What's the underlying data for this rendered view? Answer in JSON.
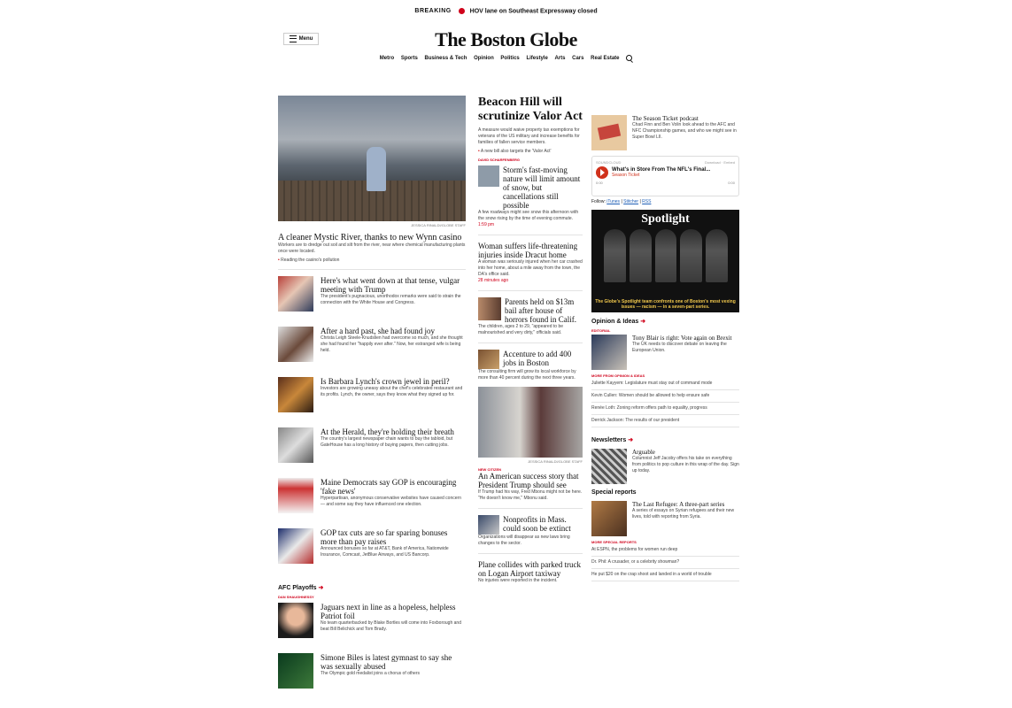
{
  "breaking": {
    "tag": "BREAKING",
    "text": "HOV lane on Southeast Expressway closed"
  },
  "header": {
    "menu_label": "Menu",
    "logo": "The Boston Globe",
    "nav": [
      "Metro",
      "Sports",
      "Business & Tech",
      "Opinion",
      "Politics",
      "Lifestyle",
      "Arts",
      "Cars",
      "Real Estate"
    ]
  },
  "col1": {
    "hero_credit": "JESSICA RINALDI/GLOBE STAFF",
    "lead_head": "A cleaner Mystic River, thanks to new Wynn casino",
    "lead_summary": "Workers are to dredge out soil and silt from the river, near where chemical manufacturing plants once were located.",
    "lead_bullet": "Reading the casino's pollution",
    "stories": [
      {
        "head": "Here's what went down at that tense, vulgar meeting with Trump",
        "summary": "The president's pugnacious, unorthodox remarks were said to strain the connection with the White House and Congress."
      },
      {
        "head": "After a hard past, she had found joy",
        "summary": "Christa Leigh Steele-Knudslien had overcome so much, and she thought she had found her \"happily ever after.\" Now, her estranged wife is being held."
      },
      {
        "head": "Is Barbara Lynch's crown jewel in peril?",
        "summary": "Investors are growing uneasy about the chef's celebrated restaurant and its profits. Lynch, the owner, says they know what they signed up for."
      },
      {
        "head": "At the Herald, they're holding their breath",
        "summary": "The country's largest newspaper chain wants to buy the tabloid, but GateHouse has a long history of buying papers, then cutting jobs."
      },
      {
        "head": "Maine Democrats say GOP is encouraging 'fake news'",
        "summary": "Hyperpartisan, anonymous conservative websites have caused concern — and some say they have influenced one election."
      },
      {
        "head": "GOP tax cuts are so far sparing bonuses more than pay raises",
        "summary": "Announced bonuses so far at AT&T, Bank of America, Nationwide Insurance, Comcast, JetBlue Airways, and US Bancorp."
      }
    ],
    "afc_label": "AFC Playoffs",
    "afc_kicker": "DAN SHAUGHNESSY",
    "afc_stories": [
      {
        "head": "Jaguars next in line as a hopeless, helpless Patriot foil",
        "summary": "No team quarterbacked by Blake Bortles will come into Foxborough and beat Bill Belichick and Tom Brady."
      },
      {
        "head": "Simone Biles is latest gymnast to say she was sexually abused",
        "summary": "The Olympic gold medalist joins a chorus of others"
      }
    ]
  },
  "col2": {
    "lead_head": "Beacon Hill will scrutinize Valor Act",
    "lead_summary": "A measure would waive property tax exemptions for veterans of the US military and increase benefits for families of fallen service members.",
    "lead_bullet": "A new bill also targets the 'Valor Act'",
    "kicker": "DAVID SCHARFENBERG",
    "stories": [
      {
        "head": "Storm's fast-moving nature will limit amount of snow, but cancellations still possible",
        "summary": "A few roadways might see snow this afternoon with the snow rising by the time of evening commute.",
        "tag": "1:59 pm"
      },
      {
        "head": "Woman suffers life-threatening injuries inside Dracut home",
        "summary": "A woman was seriously injured when her car crashed into her home, about a mile away from the town, the DA's office said.",
        "tag": "28 minutes ago"
      },
      {
        "head": "Parents held on $13m bail after house of horrors found in Calif.",
        "summary": "The children, ages 2 to 29, \"appeared to be malnourished and very dirty,\" officials said."
      },
      {
        "head": "Accenture to add 400 jobs in Boston",
        "summary": "The consulting firm will grow its local workforce by more than 40 percent during the next three years."
      }
    ],
    "portrait_credit": "JESSICA RINALDI/GLOBE STAFF",
    "feature_kicker": "NEW CITIZEN",
    "feature_head": "An American success story that President Trump should see",
    "feature_summary": "If Trump had his way, Fred Mbonu might not be here. \"He doesn't know me,\" Mbonu said.",
    "more_stories": [
      {
        "head": "Nonprofits in Mass. could soon be extinct",
        "summary": "Organizations will disappear as new laws bring changes to the sector."
      },
      {
        "head": "Plane collides with parked truck on Logan Airport taxiway",
        "summary": "No injuries were reported in the incident."
      }
    ]
  },
  "col3": {
    "podcast_title": "The Season Ticket podcast",
    "podcast_desc": "Chad Finn and Ben Volin look ahead to the AFC and NFC Championship games, and who we might see in Super Bowl LII.",
    "player": {
      "brand": "SOUNDCLOUD",
      "episode": "What's in Store From The NFL's Final...",
      "show": "Season Ticket",
      "time_start": "0:00",
      "time_end": "0:00",
      "download": "Download",
      "embed": "Embed"
    },
    "follow": {
      "label": "Follow:",
      "links": [
        "iTunes",
        "Stitcher",
        "RSS"
      ]
    },
    "spotlight": {
      "title": "Spotlight",
      "caption": "The Globe's Spotlight team confronts one of Boston's most vexing issues — racism — in a seven-part series."
    },
    "opinion": {
      "label": "Opinion & Ideas",
      "kicker": "EDITORIAL",
      "head": "Tony Blair is right: Vote again on Brexit",
      "summary": "The UK needs to discover debate on leaving the European Union.",
      "kicker2": "MORE FROM OPINION & IDEAS",
      "items": [
        "Juliette Kayyem: Legislature must stay out of command mode",
        "Kevin Cullen: Women should be allowed to help ensure safe",
        "Renée Loth: Zoning reform offers path to equality, progress",
        "Derrick Jackson: The results of our president"
      ]
    },
    "newsletters": {
      "label": "Newsletters",
      "title": "Arguable",
      "desc": "Columnist Jeff Jacoby offers his take on everything from politics to pop culture in this wrap of the day. Sign up today."
    },
    "special": {
      "label": "Special reports",
      "head": "The Last Refugee: A three-part series",
      "summary": "A series of essays on Syrian refugees and their new lives, told with reporting from Syria.",
      "kicker": "MORE SPECIAL REPORTS",
      "items": [
        "At ESPN, the problems for women run deep",
        "Dr. Phil: A crusader, or a celebrity showman?",
        "He put $20 on the crap shoot and landed in a world of trouble"
      ]
    }
  }
}
